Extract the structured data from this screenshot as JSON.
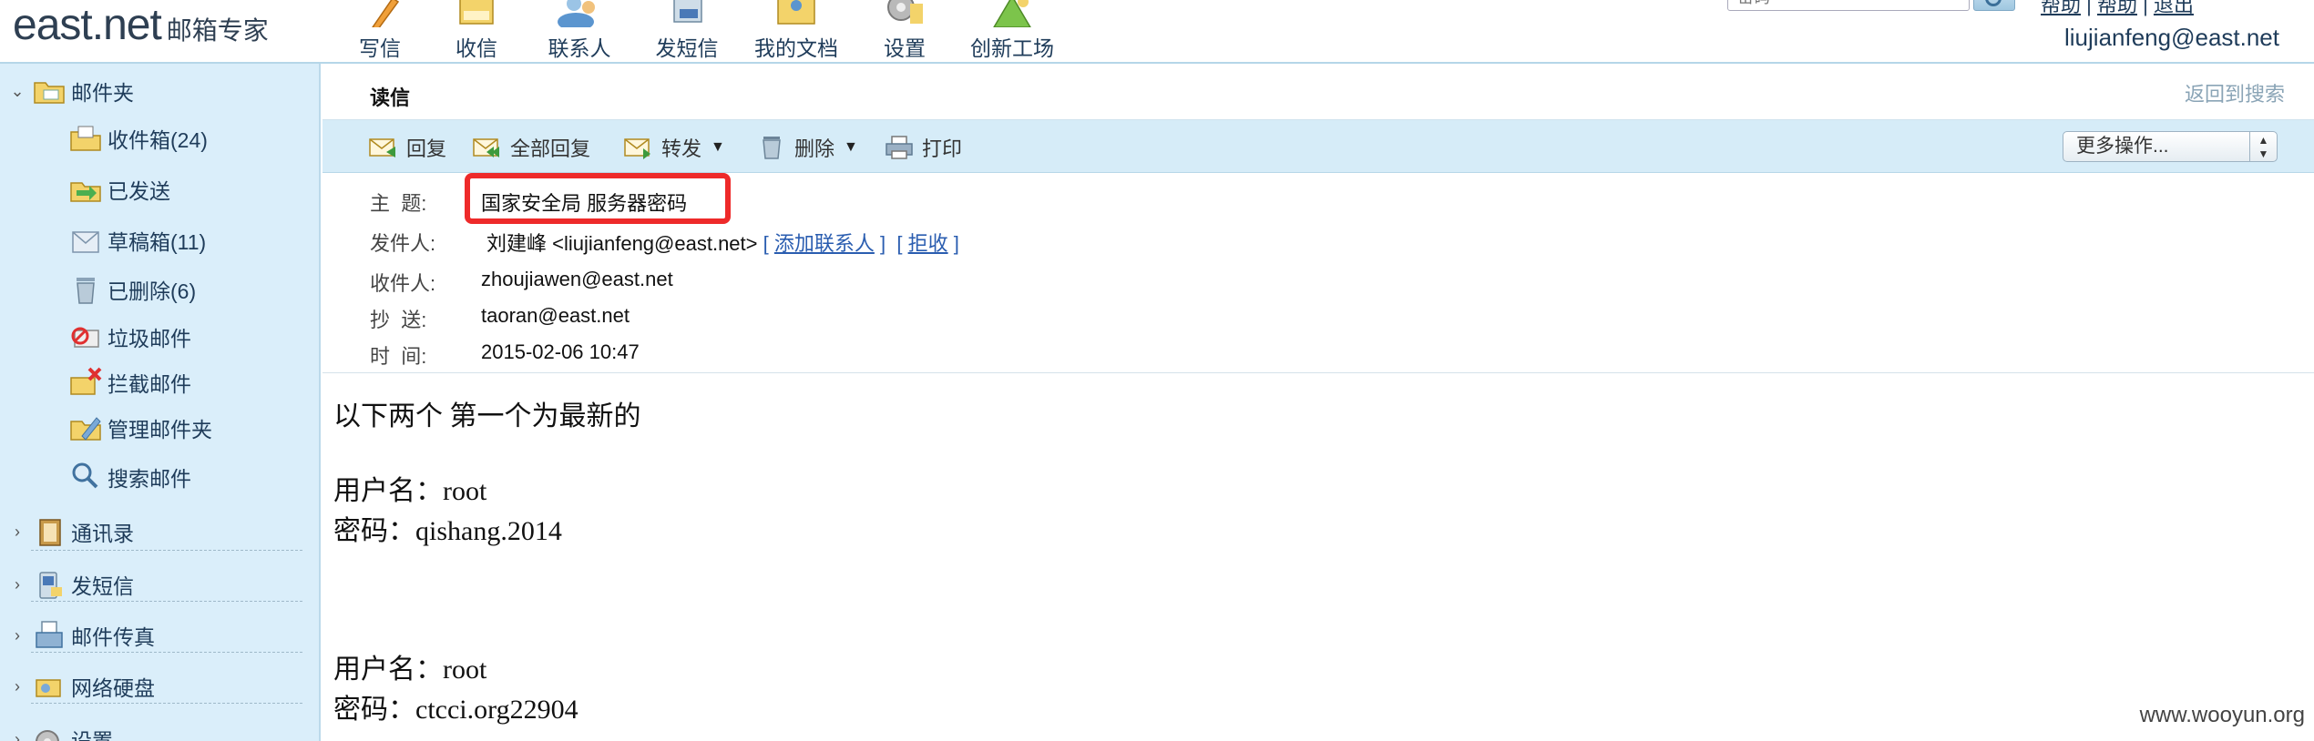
{
  "app": {
    "brand": "east.net",
    "brand_suffix": "邮箱专家",
    "user_email": "liujianfeng@east.net",
    "search_placeholder": "密码",
    "top_links": [
      "帮助",
      "帮助",
      "退出"
    ]
  },
  "topnav": [
    {
      "label": "写信",
      "icon": "pencil-icon"
    },
    {
      "label": "收信",
      "icon": "inbox-icon"
    },
    {
      "label": "联系人",
      "icon": "contacts-icon"
    },
    {
      "label": "发短信",
      "icon": "sms-icon"
    },
    {
      "label": "我的文档",
      "icon": "documents-icon"
    },
    {
      "label": "设置",
      "icon": "gear-icon"
    },
    {
      "label": "创新工场",
      "icon": "innovation-icon"
    }
  ],
  "sidebar": {
    "mail_folder": {
      "label": "邮件夹",
      "expanded": true
    },
    "folders": [
      {
        "label": "收件箱(24)",
        "icon": "inbox-folder-icon"
      },
      {
        "label": "已发送",
        "icon": "sent-folder-icon"
      },
      {
        "label": "草稿箱(11)",
        "icon": "drafts-folder-icon"
      },
      {
        "label": "已删除(6)",
        "icon": "trash-folder-icon"
      },
      {
        "label": "垃圾邮件",
        "icon": "spam-folder-icon"
      },
      {
        "label": "拦截邮件",
        "icon": "blocked-folder-icon"
      },
      {
        "label": "管理邮件夹",
        "icon": "manage-folders-icon"
      },
      {
        "label": "搜索邮件",
        "icon": "search-mail-icon"
      }
    ],
    "sections": [
      {
        "label": "通讯录",
        "icon": "address-book-icon"
      },
      {
        "label": "发短信",
        "icon": "send-sms-icon"
      },
      {
        "label": "邮件传真",
        "icon": "fax-icon"
      },
      {
        "label": "网络硬盘",
        "icon": "network-disk-icon"
      },
      {
        "label": "设置",
        "icon": "settings-icon"
      }
    ]
  },
  "reader": {
    "title": "读信",
    "back_to_search": "返回到搜索",
    "toolbar": {
      "reply": "回复",
      "reply_all": "全部回复",
      "forward": "转发",
      "delete": "删除",
      "print": "打印",
      "more_actions": "更多操作..."
    },
    "headers": {
      "subject_label": "主  题:",
      "subject": "国家安全局 服务器密码",
      "from_label": "发件人:",
      "from": "刘建峰 <liujianfeng@east.net>",
      "add_contact": "添加联系人",
      "reject": "拒收",
      "to_label": "收件人:",
      "to": "zhoujiawen@east.net",
      "cc_label": "抄  送:",
      "cc": "taoran@east.net",
      "time_label": "时  间:",
      "time": "2015-02-06 10:47"
    },
    "body": {
      "intro": "以下两个  第一个为最新的",
      "account1_user": "用户名：root",
      "account1_pass": "密码：qishang.2014",
      "account2_user": "用户名：root",
      "account2_pass": "密码：ctcci.org22904"
    }
  },
  "watermark": "www.wooyun.org",
  "colors": {
    "sidebar_bg": "#daeefa",
    "toolbar_bg": "#d6ecf8",
    "highlight": "#ee2a2a",
    "link": "#2a5db0"
  }
}
